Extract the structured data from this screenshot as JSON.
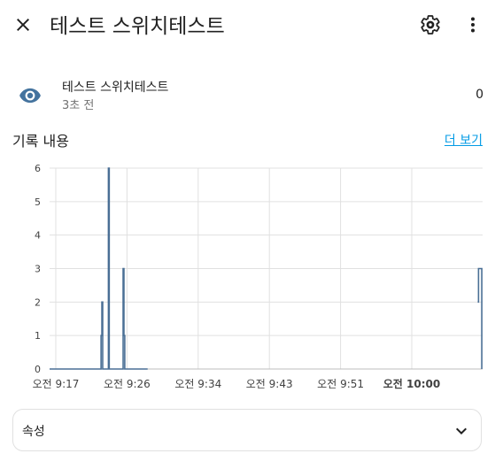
{
  "dialog": {
    "title": "테스트 스위치테스트"
  },
  "icons": {
    "close": "close-icon",
    "settings": "gear-icon",
    "more": "more-vertical-icon",
    "entity": "eye-icon",
    "expand": "chevron-down-icon"
  },
  "entity": {
    "name": "테스트 스위치테스트",
    "last_changed": "3초 전",
    "state": "0"
  },
  "history": {
    "title": "기록 내용",
    "show_more": "더 보기"
  },
  "attributes": {
    "label": "속성"
  },
  "colors": {
    "accent": "#039be5",
    "series": "#4a6f95",
    "icon": "#44739e"
  },
  "chart_data": {
    "type": "line",
    "title": "",
    "xlabel": "",
    "ylabel": "",
    "ylim": [
      0,
      6
    ],
    "y_ticks": [
      "0",
      "1",
      "2",
      "3",
      "4",
      "5",
      "6"
    ],
    "x_ticks": [
      {
        "label": "오전 9:17",
        "bold": false
      },
      {
        "label": "오전 9:26",
        "bold": false
      },
      {
        "label": "오전 9:34",
        "bold": false
      },
      {
        "label": "오전 9:43",
        "bold": false
      },
      {
        "label": "오전 9:51",
        "bold": false
      },
      {
        "label": "오전 10:00",
        "bold": true
      }
    ],
    "x_range": [
      "09:15",
      "10:08"
    ],
    "grid": true,
    "series": [
      {
        "step": true,
        "segments": [
          [
            [
              "09:15",
              0
            ],
            [
              "09:21.3",
              0
            ],
            [
              "09:21.3",
              1
            ],
            [
              "09:21.4",
              1
            ],
            [
              "09:21.4",
              2
            ],
            [
              "09:21.5",
              2
            ],
            [
              "09:21.5",
              0
            ],
            [
              "09:22.2",
              0
            ],
            [
              "09:22.2",
              6
            ],
            [
              "09:22.3",
              6
            ],
            [
              "09:22.3",
              0
            ],
            [
              "09:24.0",
              0
            ],
            [
              "09:24.0",
              3
            ],
            [
              "09:24.1",
              3
            ],
            [
              "09:24.1",
              1
            ],
            [
              "09:24.2",
              1
            ],
            [
              "09:24.2",
              0
            ],
            [
              "09:27.0",
              0
            ]
          ],
          [
            [
              "10:07.4",
              2
            ],
            [
              "10:07.5",
              2
            ],
            [
              "10:07.5",
              3
            ],
            [
              "10:07.9",
              3
            ],
            [
              "10:07.9",
              0
            ]
          ]
        ]
      }
    ]
  }
}
